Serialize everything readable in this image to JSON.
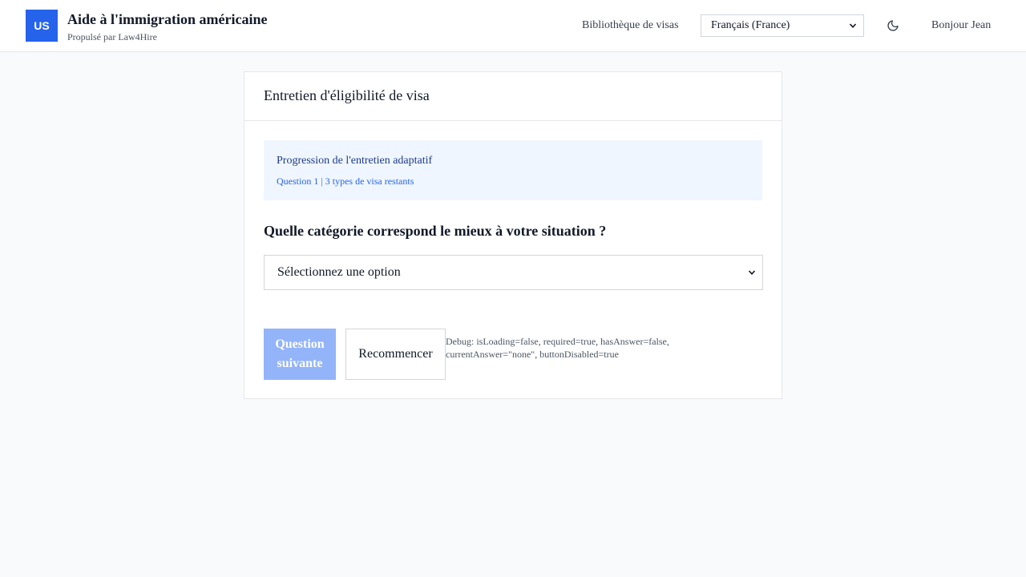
{
  "header": {
    "logo_text": "US",
    "title": "Aide à l'immigration américaine",
    "subtitle": "Propulsé par Law4Hire",
    "nav_link": "Bibliothèque de visas",
    "language": "Français (France)",
    "theme_icon": "moon-icon",
    "greeting": "Bonjour Jean"
  },
  "card": {
    "title": "Entretien d'éligibilité de visa",
    "progress": {
      "title": "Progression de l'entretien adaptatif",
      "subtitle": "Question 1 | 3 types de visa restants"
    },
    "question": "Quelle catégorie correspond le mieux à votre situation ?",
    "select_placeholder": "Sélectionnez une option",
    "next_button": "Question suivante",
    "restart_button": "Recommencer",
    "debug_text": "Debug: isLoading=false, required=true, hasAnswer=false, currentAnswer=\"none\", buttonDisabled=true"
  },
  "colors": {
    "accent": "#2563eb",
    "disabled_button": "#93b4f8",
    "progress_bg": "#eff6ff",
    "page_bg": "#f8fafc"
  }
}
